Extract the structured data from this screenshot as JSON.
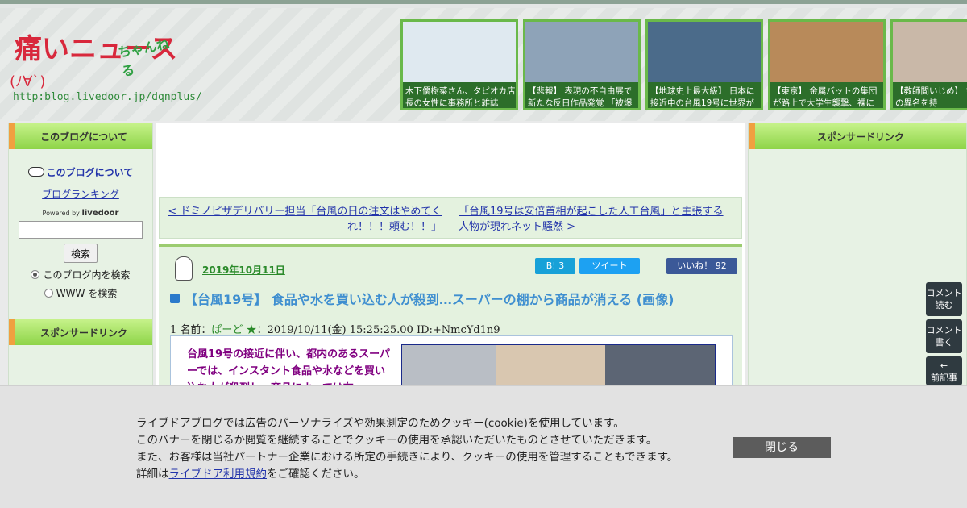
{
  "header": {
    "logo": {
      "title": "痛いニュース",
      "chan": "ちゃんねる",
      "face": "(ﾉ∀`)",
      "url": "http:blog.livedoor.jp/dqnplus/"
    },
    "thumbnails": [
      {
        "caption": "木下優樹菜さん、タピオカ店長の女性に事務所と雑誌",
        "color": "#dfe9f0"
      },
      {
        "caption": "【悲報】 表現の不自由展で新たな反日作品発覚 「被爆",
        "color": "#8ea3b8"
      },
      {
        "caption": "【地球史上最大級】 日本に接近中の台風19号に世界が",
        "color": "#4b6b8a"
      },
      {
        "caption": "【東京】 金属バットの集団が路上で大学生襲撃、裸に",
        "color": "#b88a5a"
      },
      {
        "caption": "【教師間いじめ】 主「女帝」の異名を持",
        "color": "#c9b8a8"
      }
    ]
  },
  "left": {
    "about_heading": "このブログについて",
    "about_link": "このブログについて",
    "ranking_link": "ブログランキング",
    "powered_prefix": "Powered by",
    "powered_brand": "livedoor",
    "search_button": "検索",
    "radio_blog": "このブログ内を検索",
    "radio_www": "WWW を検索",
    "sponsor_heading": "スポンサードリンク"
  },
  "right": {
    "sponsor_heading": "スポンサードリンク"
  },
  "nav": {
    "prev": "< ドミノピザデリバリー担当「台風の日の注文はやめてくれ！！！頼む！！」",
    "next": "「台風19号は安倍首相が起こした人工台風」と主張する人物が現れネット騒然 >"
  },
  "article": {
    "date": "2019年10月11日",
    "hatena_label": "B! 3",
    "tweet_label": "ツイート",
    "like_label": "いいね！ 92",
    "title": "【台風19号】 食品や水を買い込む人が殺到…スーパーの棚から商品が消える (画像)",
    "res_prefix": "1 名前：",
    "res_name": "ぱーど ★",
    "res_suffix": "：2019/10/11(金) 15:25:25.00 ID:+NmcYd1n9",
    "quote": "台風19号の接近に伴い、都内のあるスーパーでは、インスタント食品や水などを買い込む人が殺到し、商品によっては在"
  },
  "float_buttons": {
    "comment_read": "コメント読む",
    "comment_write": "コメント書く",
    "prev_article": "前記事"
  },
  "cookie": {
    "line1": "ライブドアブログでは広告のパーソナライズや効果測定のためクッキー(cookie)を使用しています。",
    "line2": "このバナーを閉じるか閲覧を継続することでクッキーの使用を承認いただいたものとさせていただきます。",
    "line3": "また、お客様は当社パートナー企業における所定の手続きにより、クッキーの使用を管理することもできます。",
    "line4_prefix": "詳細は",
    "line4_link": "ライブドア利用規約",
    "line4_suffix": "をご確認ください。",
    "close_button": "閉じる"
  }
}
